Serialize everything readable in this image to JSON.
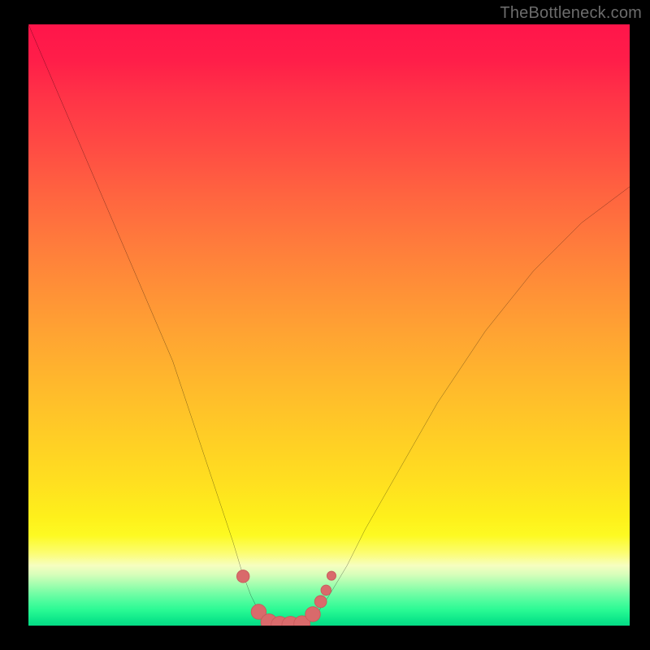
{
  "watermark": "TheBottleneck.com",
  "colors": {
    "frame": "#000000",
    "curve_stroke": "#000000",
    "marker_fill": "#d96a6b",
    "marker_stroke": "#c85a5b"
  },
  "chart_data": {
    "type": "line",
    "title": "",
    "xlabel": "",
    "ylabel": "",
    "xlim": [
      0,
      100
    ],
    "ylim": [
      0,
      100
    ],
    "grid": false,
    "legend": false,
    "note": "No axis ticks or labels are visible; x/y values are estimated in percent of plot width/height. y is bottleneck percentage (0 at bottom). Background gradient goes red→yellow→green top→bottom.",
    "series": [
      {
        "name": "bottleneck-curve",
        "x": [
          0,
          3,
          6,
          9,
          12,
          15,
          18,
          21,
          24,
          26,
          28,
          30,
          32,
          34,
          35.5,
          37,
          38.5,
          40,
          42,
          44,
          46,
          48,
          50,
          53,
          56,
          60,
          64,
          68,
          72,
          76,
          80,
          84,
          88,
          92,
          96,
          100
        ],
        "y": [
          100,
          93,
          86,
          79,
          72,
          65,
          58,
          51,
          44,
          38,
          32,
          26,
          20,
          14,
          9,
          5,
          2,
          0.5,
          0,
          0,
          0.5,
          2,
          5,
          10,
          16,
          23,
          30,
          37,
          43,
          49,
          54,
          59,
          63,
          67,
          70,
          73
        ]
      }
    ],
    "markers": {
      "name": "highlighted-points",
      "x": [
        35.7,
        38.3,
        40,
        41.8,
        43.6,
        45.5,
        47.3,
        48.6,
        49.5,
        50.4
      ],
      "y": [
        8.2,
        2.3,
        0.6,
        0.1,
        0.1,
        0.3,
        1.9,
        4.0,
        5.9,
        8.3
      ],
      "r": [
        1.05,
        1.25,
        1.35,
        1.45,
        1.45,
        1.35,
        1.25,
        1.0,
        0.85,
        0.75
      ]
    }
  }
}
